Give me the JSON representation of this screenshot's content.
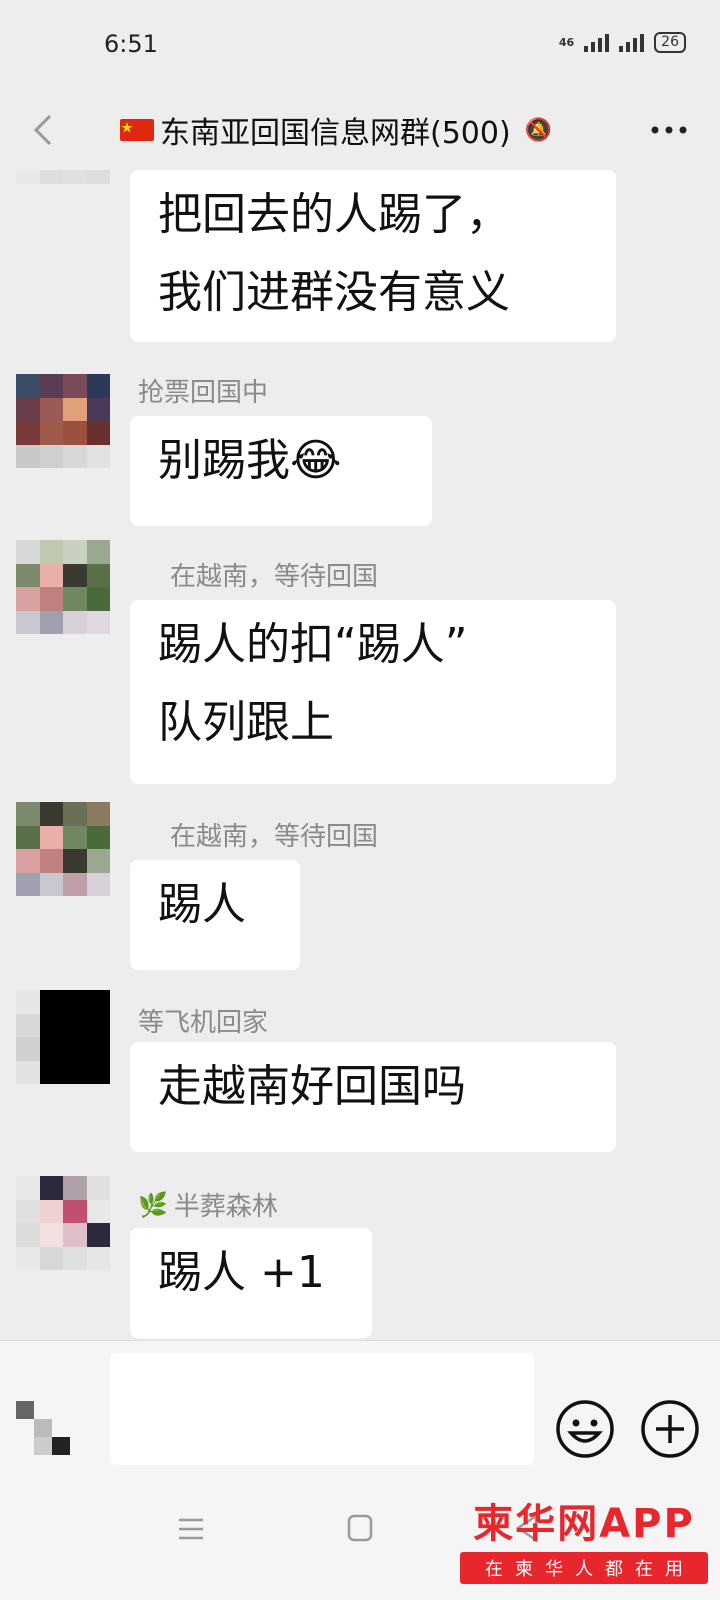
{
  "status_bar": {
    "time": "6:51",
    "network_label": "46",
    "battery": "26"
  },
  "header": {
    "title": "东南亚回国信息网群(500)"
  },
  "messages": [
    {
      "sender": "",
      "text": "把回去的人踢了，\n我们进群没有意义"
    },
    {
      "sender": "抢票回国中",
      "text": "别踢我😂"
    },
    {
      "sender": "在越南，等待回国",
      "text": "踢人的扣“踢人”\n队列跟上"
    },
    {
      "sender": "在越南，等待回国",
      "text": "踢人"
    },
    {
      "sender": "等飞机回家",
      "text": "走越南好回国吗"
    },
    {
      "sender": "半葬森林",
      "text": "踢人 +1"
    }
  ],
  "input": {
    "placeholder": ""
  },
  "watermark": {
    "brand": "柬华网APP",
    "slogan": "在柬华人都在用"
  }
}
